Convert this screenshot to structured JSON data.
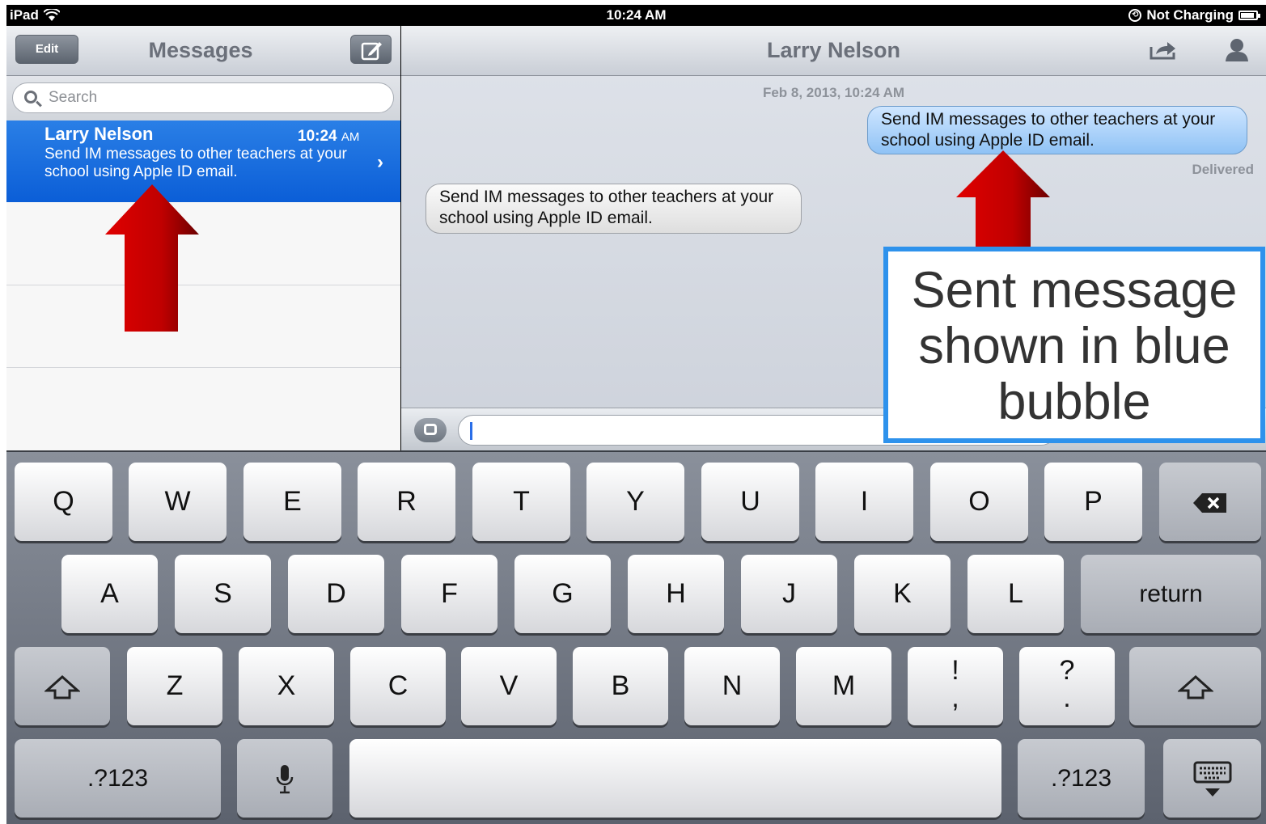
{
  "status_bar": {
    "device": "iPad",
    "time": "10:24 AM",
    "charging": "Not Charging"
  },
  "left_pane": {
    "edit_label": "Edit",
    "title": "Messages",
    "search_placeholder": "Search",
    "conversation": {
      "name": "Larry Nelson",
      "time": "10:24",
      "time_suffix": "AM",
      "preview": "Send IM messages to other teachers at your school using Apple ID email."
    }
  },
  "right_pane": {
    "title": "Larry Nelson",
    "timestamp": "Feb 8, 2013, 10:24 AM",
    "sent_message": "Send IM messages to other teachers at your school using Apple ID email.",
    "sent_status": "Delivered",
    "received_message": "Send IM messages to other teachers at your school using Apple ID email."
  },
  "callout": {
    "text": "Sent message shown in blue bubble"
  },
  "keyboard": {
    "row1": [
      "Q",
      "W",
      "E",
      "R",
      "T",
      "Y",
      "U",
      "I",
      "O",
      "P"
    ],
    "row2": [
      "A",
      "S",
      "D",
      "F",
      "G",
      "H",
      "J",
      "K",
      "L"
    ],
    "return": "return",
    "row3": [
      "Z",
      "X",
      "C",
      "V",
      "B",
      "N",
      "M"
    ],
    "excl_top": "!",
    "excl_bottom": ",",
    "quest_top": "?",
    "quest_bottom": ".",
    "numbers": ".?123"
  },
  "colors": {
    "selection_blue": "#0b5ed7",
    "callout_border": "#2e92ec",
    "arrow_red": "#d10000"
  },
  "icons": [
    "wifi-icon",
    "battery-icon",
    "compose-icon",
    "search-icon",
    "share-icon",
    "contact-icon",
    "camera-icon",
    "backspace-icon",
    "shift-icon",
    "mic-icon",
    "keyboard-dismiss-icon"
  ]
}
